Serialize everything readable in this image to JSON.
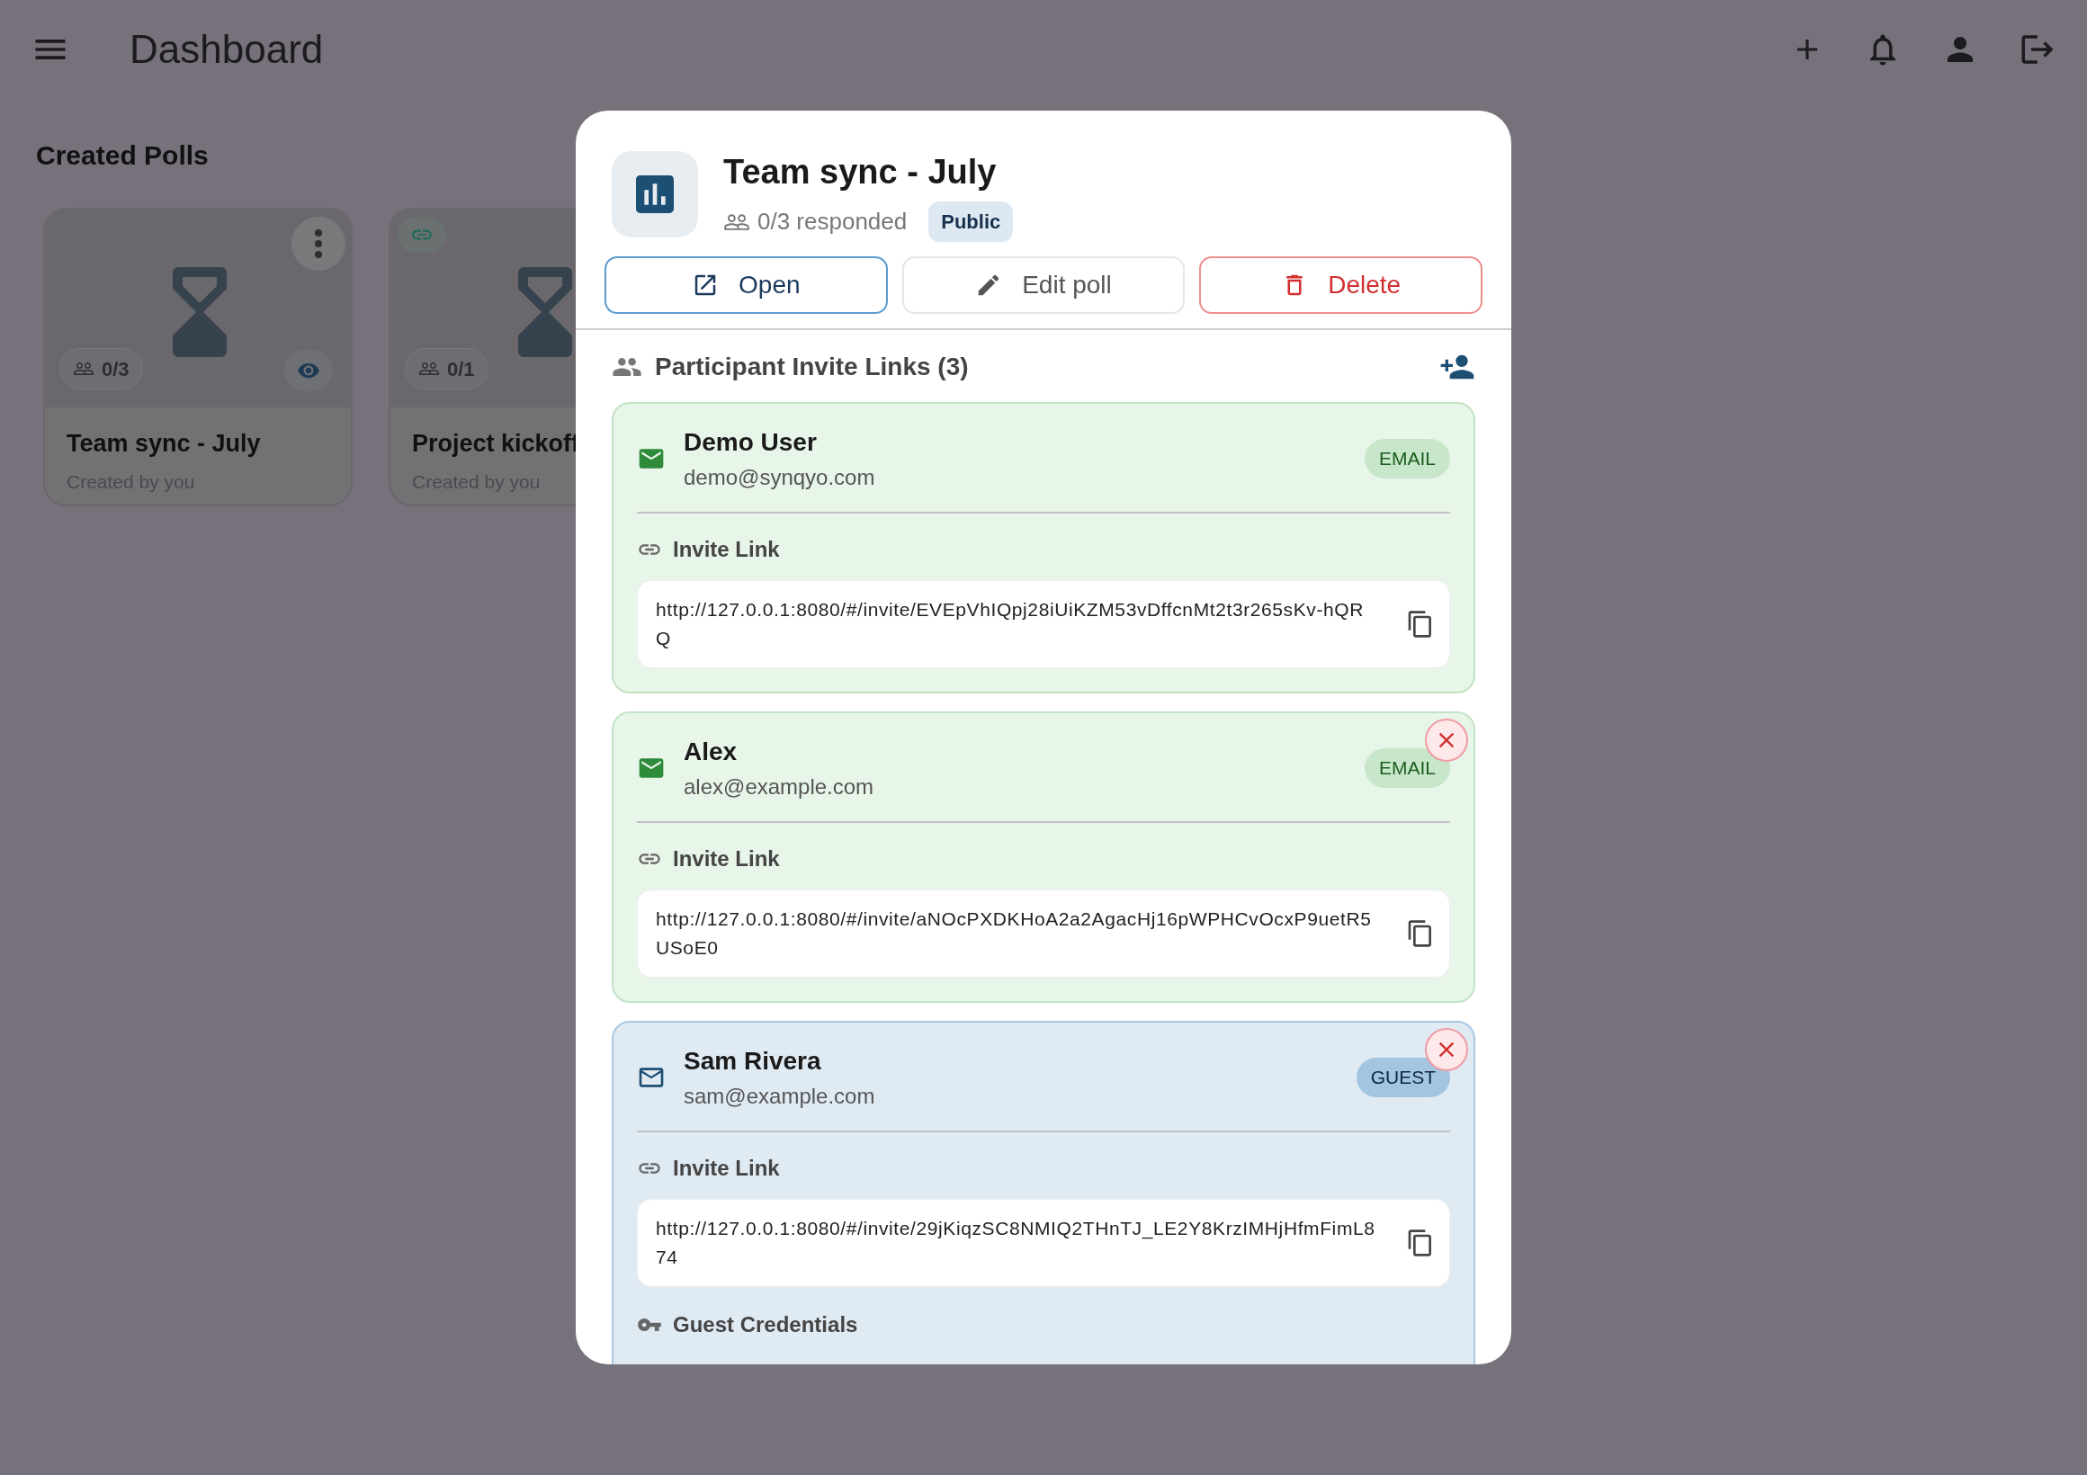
{
  "app_bar": {
    "title": "Dashboard"
  },
  "section_title": "Created Polls",
  "polls": [
    {
      "title": "Team sync - July",
      "subtitle": "Created by you",
      "count": "0/3",
      "has_link": false,
      "has_menu": true,
      "has_view": true
    },
    {
      "title": "Project kickoff",
      "subtitle": "Created by you",
      "count": "0/1",
      "has_link": true,
      "has_menu": false,
      "has_view": false
    }
  ],
  "dialog": {
    "title": "Team sync - July",
    "responded": "0/3 responded",
    "visibility": "Public",
    "actions": [
      {
        "label": "Open",
        "kind": "open"
      },
      {
        "label": "Edit poll",
        "kind": "edit"
      },
      {
        "label": "Delete",
        "kind": "delete"
      }
    ],
    "participants_title": "Participant Invite Links (3)",
    "participants": [
      {
        "name": "Demo User",
        "email": "demo@synqyo.com",
        "kind": "email",
        "badge": "EMAIL",
        "removable": false,
        "link_label": "Invite Link",
        "link": "http://127.0.0.1:8080/#/invite/EVEpVhIQpj28iUiKZM53vDffcnMt2t3r265sKv-hQRQ"
      },
      {
        "name": "Alex",
        "email": "alex@example.com",
        "kind": "email",
        "badge": "EMAIL",
        "removable": true,
        "link_label": "Invite Link",
        "link": "http://127.0.0.1:8080/#/invite/aNOcPXDKHoA2a2AgacHj16pWPHCvOcxP9uetR5USoE0"
      },
      {
        "name": "Sam Rivera",
        "email": "sam@example.com",
        "kind": "guest",
        "badge": "GUEST",
        "removable": true,
        "link_label": "Invite Link",
        "link": "http://127.0.0.1:8080/#/invite/29jKiqzSC8NMIQ2THnTJ_LE2Y8KrzIMHjHfmFimL874",
        "credentials_label": "Guest Credentials"
      }
    ]
  }
}
